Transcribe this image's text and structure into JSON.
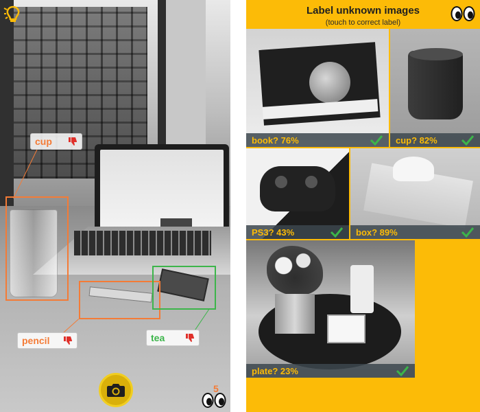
{
  "camera_screen": {
    "detections": [
      {
        "key": "cup",
        "label": "cup",
        "color": "#f47b36",
        "text_color": "#f47b36"
      },
      {
        "key": "pencil",
        "label": "pencil",
        "color": "#f47b36",
        "text_color": "#f47b36"
      },
      {
        "key": "tea",
        "label": "tea",
        "color": "#3cb54a",
        "text_color": "#3cb54a"
      }
    ],
    "unseen_count": "5",
    "capture_icon": "camera-icon",
    "feedback_icon": "thumbs-down-icon",
    "eyes_icon": "eyes-icon",
    "logo_icon": "lightbulb-logo-icon"
  },
  "label_screen": {
    "title": "Label unknown images",
    "subtitle": "(touch to correct label)",
    "accent_color": "#fcbb07",
    "caption_color": "#fcbb07",
    "check_color": "#3cb54a",
    "tiles": [
      {
        "key": "book",
        "label": "book? 76%"
      },
      {
        "key": "cup",
        "label": "cup? 82%"
      },
      {
        "key": "ps3",
        "label": "PS3? 43%"
      },
      {
        "key": "box",
        "label": "box? 89%"
      },
      {
        "key": "plate",
        "label": "plate? 23%"
      }
    ]
  }
}
